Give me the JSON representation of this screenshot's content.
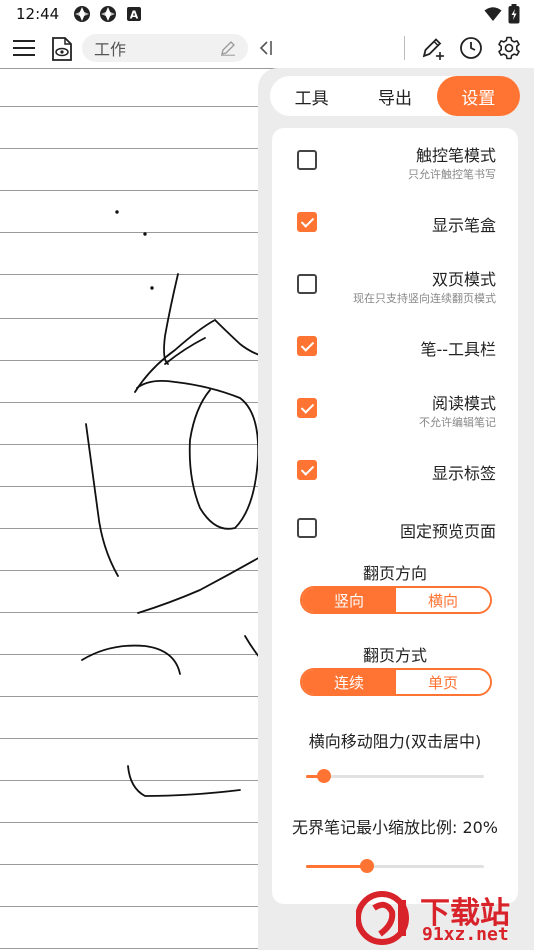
{
  "status_bar": {
    "time": "12:44",
    "badge": "A"
  },
  "toolbar": {
    "title": "工作"
  },
  "panel": {
    "tabs": [
      {
        "label": "工具",
        "active": false
      },
      {
        "label": "导出",
        "active": false
      },
      {
        "label": "设置",
        "active": true
      }
    ],
    "options": [
      {
        "label": "触控笔模式",
        "sub": "只允许触控笔书写",
        "checked": false
      },
      {
        "label": "显示笔盒",
        "sub": "",
        "checked": true
      },
      {
        "label": "双页模式",
        "sub": "现在只支持竖向连续翻页模式",
        "checked": false
      },
      {
        "label": "笔--工具栏",
        "sub": "",
        "checked": true
      },
      {
        "label": "阅读模式",
        "sub": "不允许编辑笔记",
        "checked": true
      },
      {
        "label": "显示标签",
        "sub": "",
        "checked": true
      },
      {
        "label": "固定预览页面",
        "sub": "",
        "checked": false
      }
    ],
    "page_direction": {
      "title": "翻页方向",
      "options": [
        "竖向",
        "横向"
      ],
      "selected": 0
    },
    "page_mode": {
      "title": "翻页方式",
      "options": [
        "连续",
        "单页"
      ],
      "selected": 0
    },
    "drag_resistance": {
      "label": "横向移动阻力(双击居中)",
      "value": 0.1
    },
    "min_zoom": {
      "label": "无界笔记最小缩放比例: 20%",
      "value": 0.34
    }
  },
  "watermark": {
    "text_cn": "下载站",
    "text_url": "91xz.net"
  },
  "colors": {
    "accent": "#ff7433",
    "panel_bg": "#ececec",
    "watermark": "#d8232a"
  }
}
